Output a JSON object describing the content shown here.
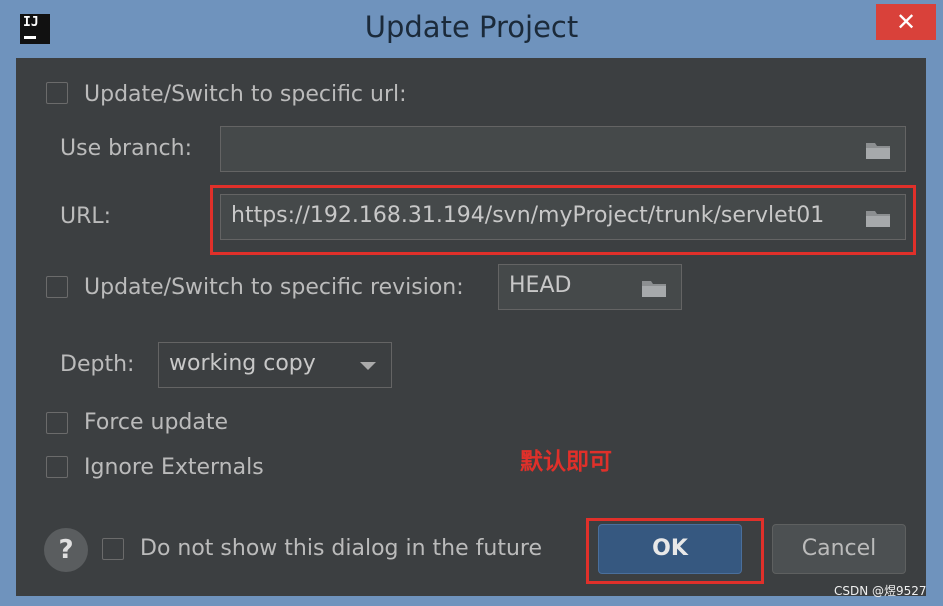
{
  "window": {
    "title": "Update Project",
    "close_glyph": "✕",
    "app_icon_text": "IJ"
  },
  "url_checkbox": {
    "label": "Update/Switch to specific url:",
    "checked": false
  },
  "branch": {
    "label": "Use branch:",
    "value": ""
  },
  "url": {
    "label": "URL:",
    "value": "https://192.168.31.194/svn/myProject/trunk/servlet01"
  },
  "revision_checkbox": {
    "label": "Update/Switch to specific revision:",
    "checked": false,
    "value": "HEAD"
  },
  "depth": {
    "label": "Depth:",
    "value": "working copy"
  },
  "force_update": {
    "label": "Force update",
    "checked": false
  },
  "ignore_externals": {
    "label": "Ignore Externals",
    "checked": false
  },
  "annotation": {
    "text": "默认即可"
  },
  "footer": {
    "help_glyph": "?",
    "dont_show_label": "Do not show this dialog in the future",
    "ok_label": "OK",
    "cancel_label": "Cancel"
  },
  "watermark": "CSDN @煜9527",
  "colors": {
    "highlight_red": "#e0302a",
    "ok_blue": "#365880",
    "dialog_bg": "#3c3f41"
  }
}
